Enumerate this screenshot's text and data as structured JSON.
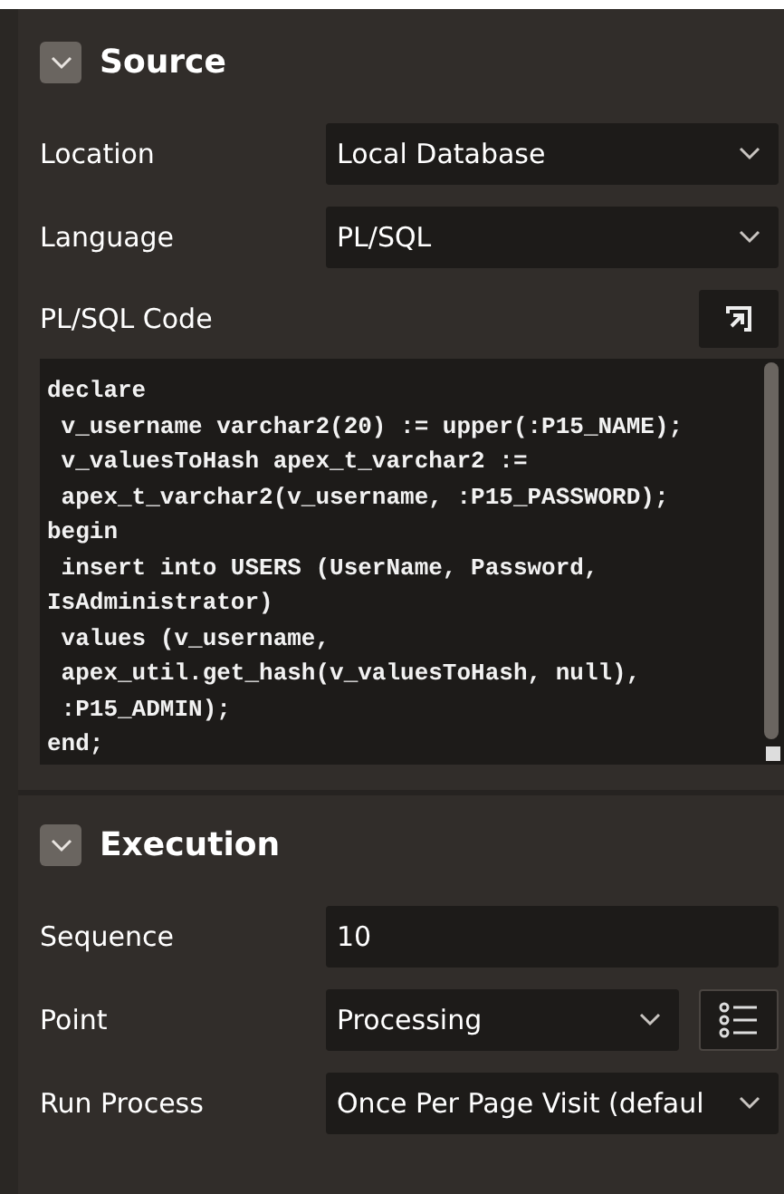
{
  "sections": [
    {
      "title": "Source",
      "expanded": true,
      "fields": [
        {
          "label": "Location",
          "kind": "select",
          "value": "Local Database"
        },
        {
          "label": "Language",
          "kind": "select",
          "value": "PL/SQL"
        }
      ],
      "code": {
        "label": "PL/SQL Code",
        "lines": [
          "declare",
          " v_username varchar2(20) := upper(:P15_NAME);",
          " v_valuesToHash apex_t_varchar2 :=",
          " apex_t_varchar2(v_username, :P15_PASSWORD);",
          "begin",
          " insert into USERS (UserName, Password,",
          "IsAdministrator)",
          " values (v_username,",
          " apex_util.get_hash(v_valuesToHash, null),",
          " :P15_ADMIN);",
          "end;"
        ]
      }
    },
    {
      "title": "Execution",
      "expanded": true,
      "fields": [
        {
          "label": "Sequence",
          "kind": "text",
          "value": "10"
        },
        {
          "label": "Point",
          "kind": "select_list",
          "value": "Processing"
        },
        {
          "label": "Run Process",
          "kind": "select",
          "value": "Once Per Page Visit (defaul"
        }
      ]
    }
  ]
}
